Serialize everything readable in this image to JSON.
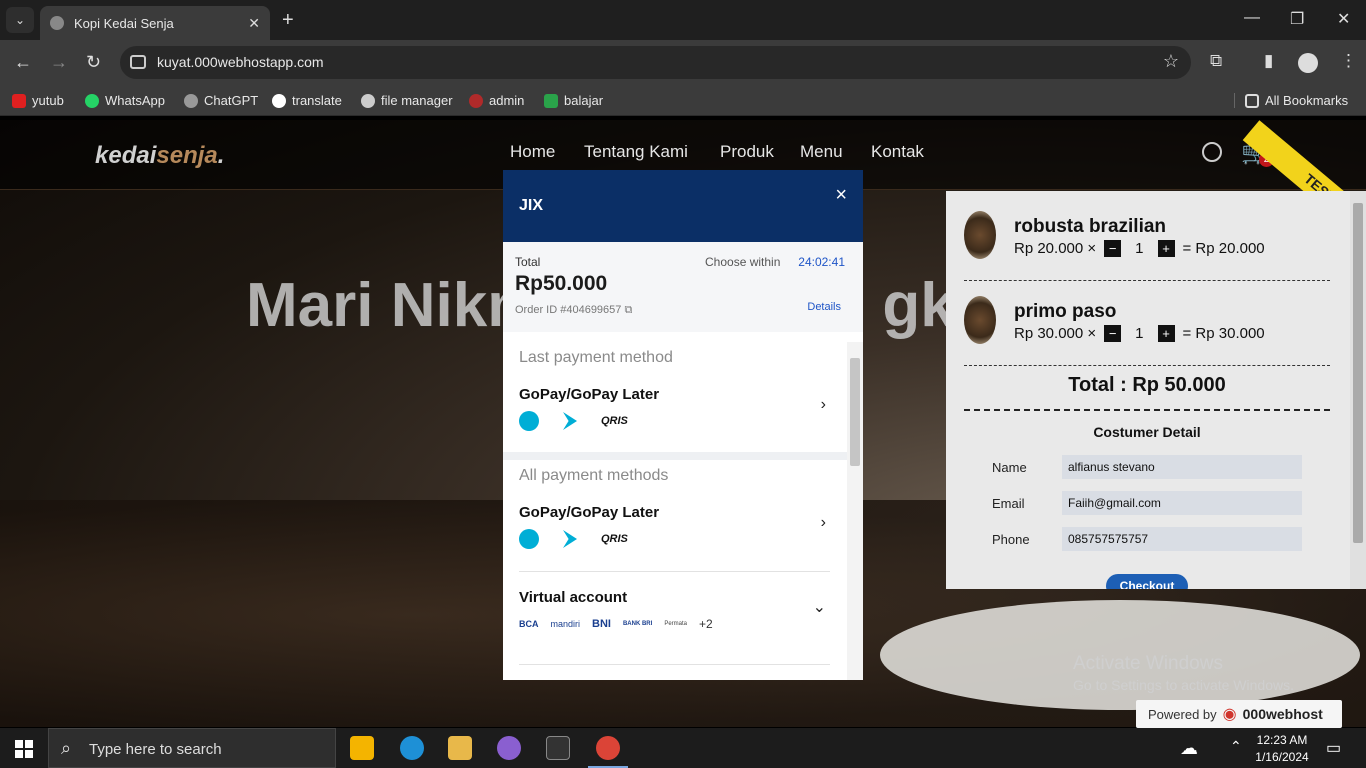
{
  "browser": {
    "tab_title": "Kopi Kedai Senja",
    "url": "kuyat.000webhostapp.com",
    "bookmarks": [
      "yutub",
      "WhatsApp",
      "ChatGPT",
      "translate",
      "file manager",
      "admin",
      "balajar"
    ],
    "all_bookmarks": "All Bookmarks"
  },
  "site": {
    "logo_a": "kedai",
    "logo_b": "senja",
    "logo_c": ".",
    "nav": [
      "Home",
      "Tentang Kami",
      "Produk",
      "Menu",
      "Kontak"
    ],
    "cart_count": "2",
    "hero_text": "Mari Nikm",
    "hero_text_tail": "gki",
    "ribbon": "TEST"
  },
  "cart": {
    "items": [
      {
        "name": "robusta brazilian",
        "unit_price": "Rp 20.000 ×",
        "qty": "1",
        "subtotal": "= Rp 20.000"
      },
      {
        "name": "primo paso",
        "unit_price": "Rp 30.000 ×",
        "qty": "1",
        "subtotal": "= Rp 30.000"
      }
    ],
    "total": "Total : Rp 50.000",
    "customer_title": "Costumer Detail",
    "fields": [
      {
        "label": "Name",
        "value": "alfianus stevano"
      },
      {
        "label": "Email",
        "value": "Faiih@gmail.com"
      },
      {
        "label": "Phone",
        "value": "085757575757"
      }
    ],
    "checkout": "Checkout",
    "minus": "−",
    "plus": "+"
  },
  "modal": {
    "merchant": "JIX",
    "close": "×",
    "total_label": "Total",
    "amount": "Rp50.000",
    "order_id": "Order ID #404699657",
    "choose_within": "Choose within",
    "timer": "24:02:41",
    "details": "Details",
    "last_method_title": "Last payment method",
    "all_methods_title": "All payment methods",
    "methods": [
      {
        "name": "GoPay/GoPay Later"
      },
      {
        "name": "GoPay/GoPay Later"
      },
      {
        "name": "Virtual account"
      }
    ],
    "qris": "QRIS",
    "banks": [
      "BCA",
      "mandiri",
      "BNI",
      "BANK BRI",
      "Permata"
    ],
    "more_banks": "+2"
  },
  "overlay": {
    "activate_title": "Activate Windows",
    "activate_sub": "Go to Settings to activate Windows.",
    "powered_by": "Powered by",
    "host_brand": "000webhost"
  },
  "taskbar": {
    "search_placeholder": "Type here to search",
    "time": "12:23 AM",
    "date": "1/16/2024"
  }
}
